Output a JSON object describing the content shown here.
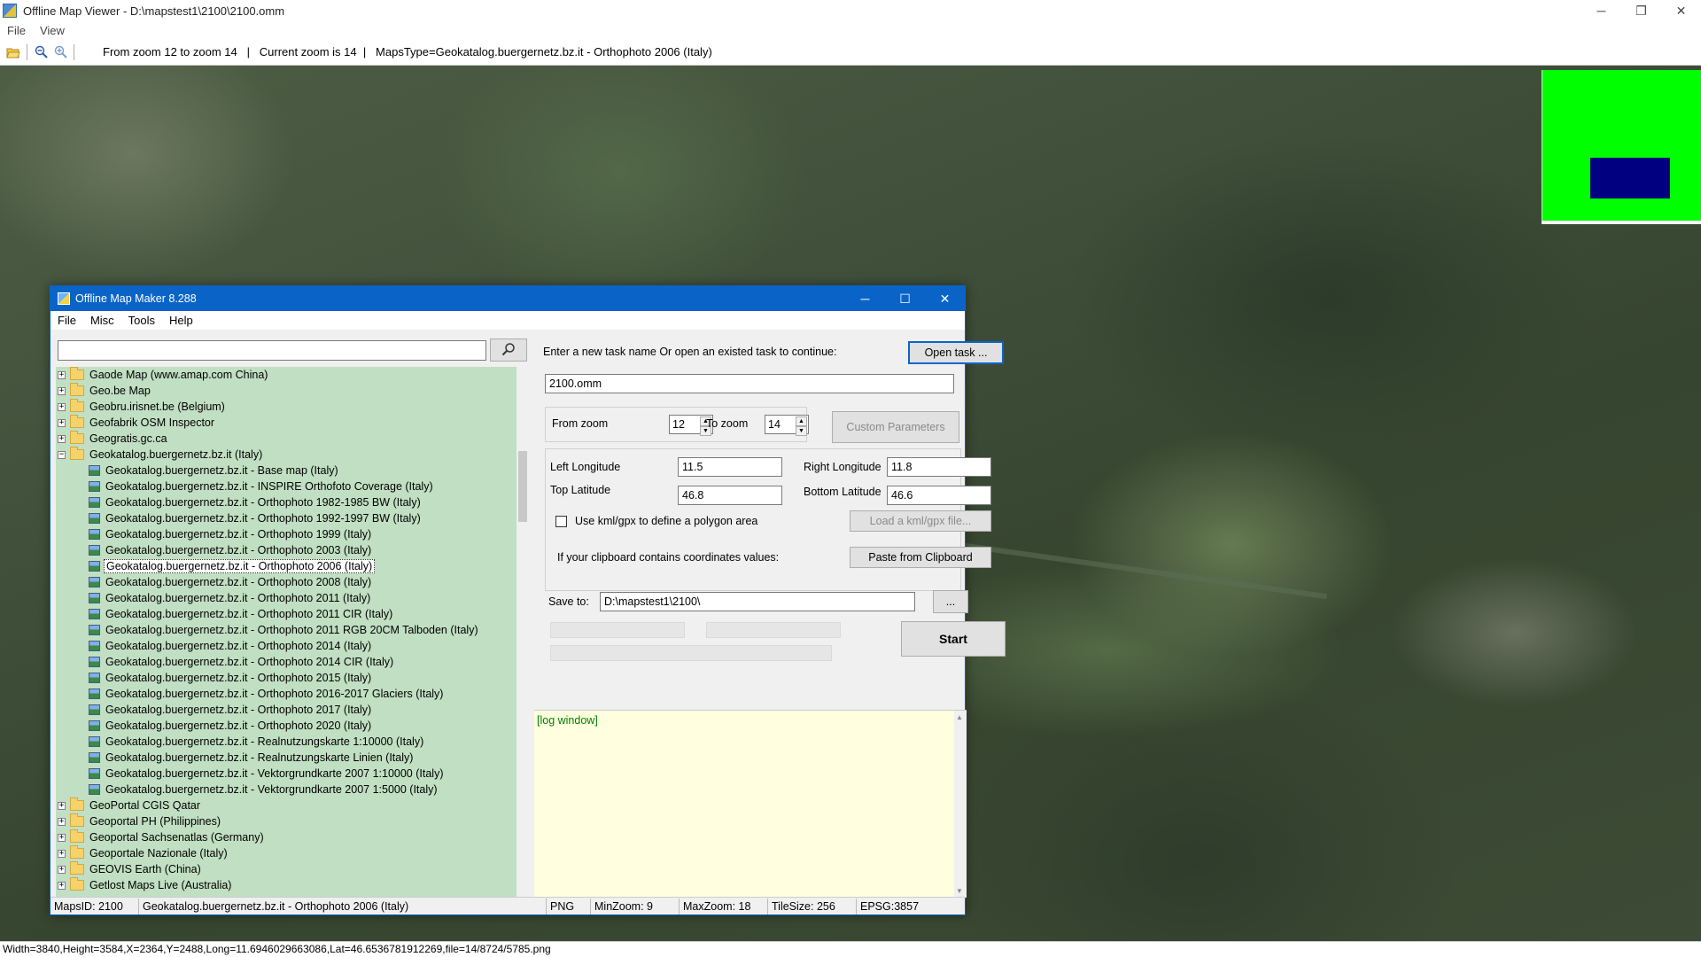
{
  "outer": {
    "title": "Offline Map Viewer - D:\\mapstest1\\2100\\2100.omm",
    "menu": [
      "File",
      "View"
    ],
    "toolbar_status": "From zoom 12 to zoom 14   |   Current zoom is 14  |   MapsType=Geokatalog.buergernetz.bz.it - Orthophoto 2006 (Italy)",
    "bottom_status": "Width=3840,Height=3584,X=2364,Y=2488,Long=11.6946029663086,Lat=46.6536781912269,file=14/8724/5785.png"
  },
  "dialog": {
    "title": "Offline Map Maker 8.288",
    "menu": [
      "File",
      "Misc",
      "Tools",
      "Help"
    ],
    "search_value": "",
    "tree": [
      {
        "label": "Gaode Map (www.amap.com China)",
        "type": "folder",
        "expander": "+"
      },
      {
        "label": "Geo.be Map",
        "type": "folder",
        "expander": "+"
      },
      {
        "label": "Geobru.irisnet.be (Belgium)",
        "type": "folder",
        "expander": "+"
      },
      {
        "label": "Geofabrik OSM Inspector",
        "type": "folder",
        "expander": "+"
      },
      {
        "label": "Geogratis.gc.ca",
        "type": "folder",
        "expander": "+"
      },
      {
        "label": "Geokatalog.buergernetz.bz.it (Italy)",
        "type": "folder",
        "expander": "−"
      },
      {
        "label": "Geokatalog.buergernetz.bz.it - Base map (Italy)",
        "type": "map"
      },
      {
        "label": "Geokatalog.buergernetz.bz.it - INSPIRE Orthofoto Coverage (Italy)",
        "type": "map"
      },
      {
        "label": "Geokatalog.buergernetz.bz.it - Orthophoto 1982-1985 BW (Italy)",
        "type": "map"
      },
      {
        "label": "Geokatalog.buergernetz.bz.it - Orthophoto 1992-1997 BW (Italy)",
        "type": "map"
      },
      {
        "label": "Geokatalog.buergernetz.bz.it - Orthophoto 1999 (Italy)",
        "type": "map"
      },
      {
        "label": "Geokatalog.buergernetz.bz.it - Orthophoto 2003 (Italy)",
        "type": "map"
      },
      {
        "label": "Geokatalog.buergernetz.bz.it - Orthophoto 2006 (Italy)",
        "type": "map",
        "selected": true
      },
      {
        "label": "Geokatalog.buergernetz.bz.it - Orthophoto 2008 (Italy)",
        "type": "map"
      },
      {
        "label": "Geokatalog.buergernetz.bz.it - Orthophoto 2011 (Italy)",
        "type": "map"
      },
      {
        "label": "Geokatalog.buergernetz.bz.it - Orthophoto 2011 CIR (Italy)",
        "type": "map"
      },
      {
        "label": "Geokatalog.buergernetz.bz.it - Orthophoto 2011 RGB 20CM Talboden (Italy)",
        "type": "map"
      },
      {
        "label": "Geokatalog.buergernetz.bz.it - Orthophoto 2014 (Italy)",
        "type": "map"
      },
      {
        "label": "Geokatalog.buergernetz.bz.it - Orthophoto 2014 CIR (Italy)",
        "type": "map"
      },
      {
        "label": "Geokatalog.buergernetz.bz.it - Orthophoto 2015 (Italy)",
        "type": "map"
      },
      {
        "label": "Geokatalog.buergernetz.bz.it - Orthophoto 2016-2017 Glaciers (Italy)",
        "type": "map"
      },
      {
        "label": "Geokatalog.buergernetz.bz.it - Orthophoto 2017 (Italy)",
        "type": "map"
      },
      {
        "label": "Geokatalog.buergernetz.bz.it - Orthophoto 2020 (Italy)",
        "type": "map"
      },
      {
        "label": "Geokatalog.buergernetz.bz.it - Realnutzungskarte 1:10000 (Italy)",
        "type": "map"
      },
      {
        "label": "Geokatalog.buergernetz.bz.it - Realnutzungskarte Linien (Italy)",
        "type": "map"
      },
      {
        "label": "Geokatalog.buergernetz.bz.it - Vektorgrundkarte 2007 1:10000 (Italy)",
        "type": "map"
      },
      {
        "label": "Geokatalog.buergernetz.bz.it - Vektorgrundkarte 2007 1:5000 (Italy)",
        "type": "map"
      },
      {
        "label": "GeoPortal CGIS Qatar",
        "type": "folder",
        "expander": "+"
      },
      {
        "label": "Geoportal PH (Philippines)",
        "type": "folder",
        "expander": "+"
      },
      {
        "label": "Geoportal Sachsenatlas (Germany)",
        "type": "folder",
        "expander": "+"
      },
      {
        "label": "Geoportale Nazionale (Italy)",
        "type": "folder",
        "expander": "+"
      },
      {
        "label": "GEOVIS Earth (China)",
        "type": "folder",
        "expander": "+"
      },
      {
        "label": "Getlost Maps Live (Australia)",
        "type": "folder",
        "expander": "+"
      }
    ],
    "task": {
      "prompt": "Enter a new task name Or open an existed task to continue:",
      "open_button": "Open task ...",
      "name_value": "2100.omm"
    },
    "zoom": {
      "from_label": "From zoom",
      "from_value": "12",
      "to_label": "To zoom",
      "to_value": "14",
      "custom_button": "Custom Parameters"
    },
    "coords": {
      "left_lon_label": "Left Longitude",
      "left_lon_value": "11.5",
      "right_lon_label": "Right Longitude",
      "right_lon_value": "11.8",
      "top_lat_label": "Top Latitude",
      "top_lat_value": "46.8",
      "bottom_lat_label": "Bottom Latitude",
      "bottom_lat_value": "46.6",
      "kml_checkbox_label": "Use kml/gpx to define a polygon area",
      "kml_button": "Load a kml/gpx file...",
      "clipboard_label": "If your clipboard contains coordinates values:",
      "clipboard_button": "Paste from Clipboard"
    },
    "save": {
      "label": "Save to:",
      "value": "D:\\mapstest1\\2100\\",
      "browse_button": "...",
      "start_button": "Start"
    },
    "log_text": "[log window]",
    "status": {
      "maps_id": "MapsID: 2100",
      "map_name": "Geokatalog.buergernetz.bz.it - Orthophoto 2006 (Italy)",
      "format": "PNG",
      "min_zoom": "MinZoom: 9",
      "max_zoom": "MaxZoom: 18",
      "tile_size": "TileSize: 256",
      "epsg": "EPSG:3857"
    }
  }
}
